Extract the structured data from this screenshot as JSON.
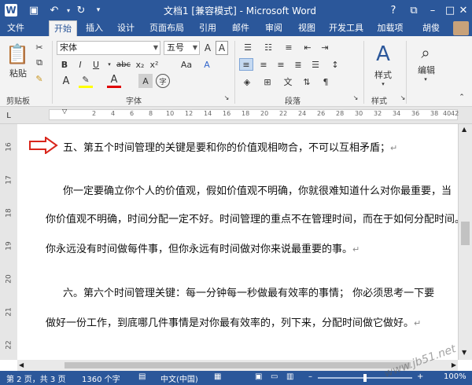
{
  "titlebar": {
    "title": "文档1 [兼容模式] - Microsoft Word",
    "help": "?"
  },
  "tabs": {
    "file": "文件",
    "items": [
      "开始",
      "插入",
      "设计",
      "页面布局",
      "引用",
      "邮件",
      "审阅",
      "视图",
      "开发工具",
      "加载项"
    ],
    "user": "胡俊"
  },
  "ribbon": {
    "clipboard": {
      "paste": "粘贴",
      "label": "剪贴板"
    },
    "font": {
      "name": "宋体",
      "size": "五号",
      "label": "字体",
      "bold": "B",
      "italic": "I",
      "underline": "U",
      "strike": "abc",
      "sub": "x₂",
      "sup": "x²",
      "aa": "Aa",
      "clear": "A"
    },
    "paragraph": {
      "label": "段落"
    },
    "styles": {
      "button": "样式",
      "label": "样式"
    },
    "editing": {
      "button": "编辑"
    }
  },
  "ruler": {
    "marks": [
      "2",
      "4",
      "6",
      "8",
      "10",
      "12",
      "14",
      "16",
      "18",
      "20",
      "22",
      "24",
      "26",
      "28",
      "30",
      "32",
      "34",
      "36",
      "38",
      "40",
      "42"
    ],
    "vmarks": [
      "16",
      "17",
      "18",
      "19",
      "20",
      "21",
      "22"
    ]
  },
  "document": {
    "line1": "五、第五个时间管理的关键是要和你的价值观相吻合，不可以互相矛盾；",
    "line2": "你一定要确立你个人的价值观，假如价值观不明确，你就很难知道什么对你最重要，当",
    "line3": "你价值观不明确，时间分配一定不好。时间管理的重点不在管理时间，而在于如何分配时间。",
    "line4": "你永远没有时间做每件事，但你永远有时间做对你来说最重要的事。",
    "line5": "六。第六个时间管理关键：每一分钟每一秒做最有效率的事情；        你必须思考一下要",
    "line6": "做好一份工作，到底哪几件事情是对你最有效率的，列下来，分配时间做它做好。",
    "para_mark": "↵"
  },
  "status": {
    "page": "第 2 页，共 3 页",
    "words": "1360 个字",
    "lang": "中文(中国)",
    "zoom": "100%"
  },
  "watermark": "www.jb51.net",
  "colors": {
    "accent": "#2b579a",
    "arrow": "#d9261c"
  }
}
